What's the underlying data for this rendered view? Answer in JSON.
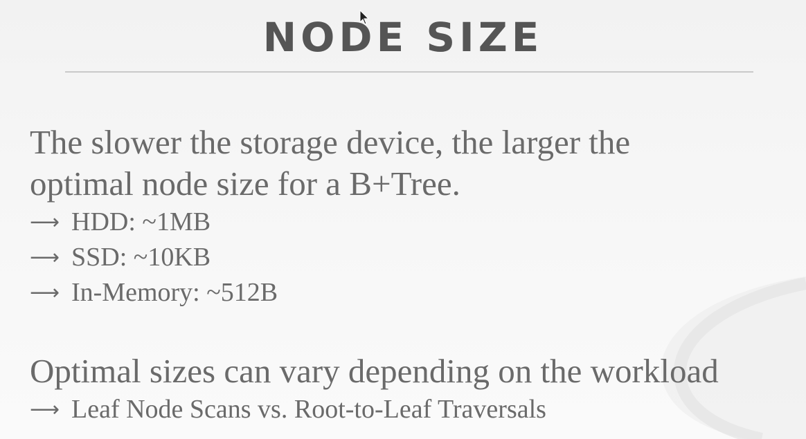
{
  "title": "NODE SIZE",
  "paragraph1": {
    "line1": "The slower the storage device, the larger the",
    "line2": "optimal node size for a B+Tree."
  },
  "bullets1": [
    {
      "arrow": "⟶",
      "text": "HDD: ~1MB"
    },
    {
      "arrow": "⟶",
      "text": "SSD: ~10KB"
    },
    {
      "arrow": "⟶",
      "text": "In-Memory: ~512B"
    }
  ],
  "paragraph2": {
    "line1": "Optimal sizes can vary depending on the workload"
  },
  "bullets2": [
    {
      "arrow": "⟶",
      "text": "Leaf Node Scans vs. Root-to-Leaf Traversals"
    }
  ],
  "colors": {
    "background": "#f5f5f5",
    "title": "#555555",
    "text": "#6a6a6a",
    "rule": "#c9c9c9"
  }
}
